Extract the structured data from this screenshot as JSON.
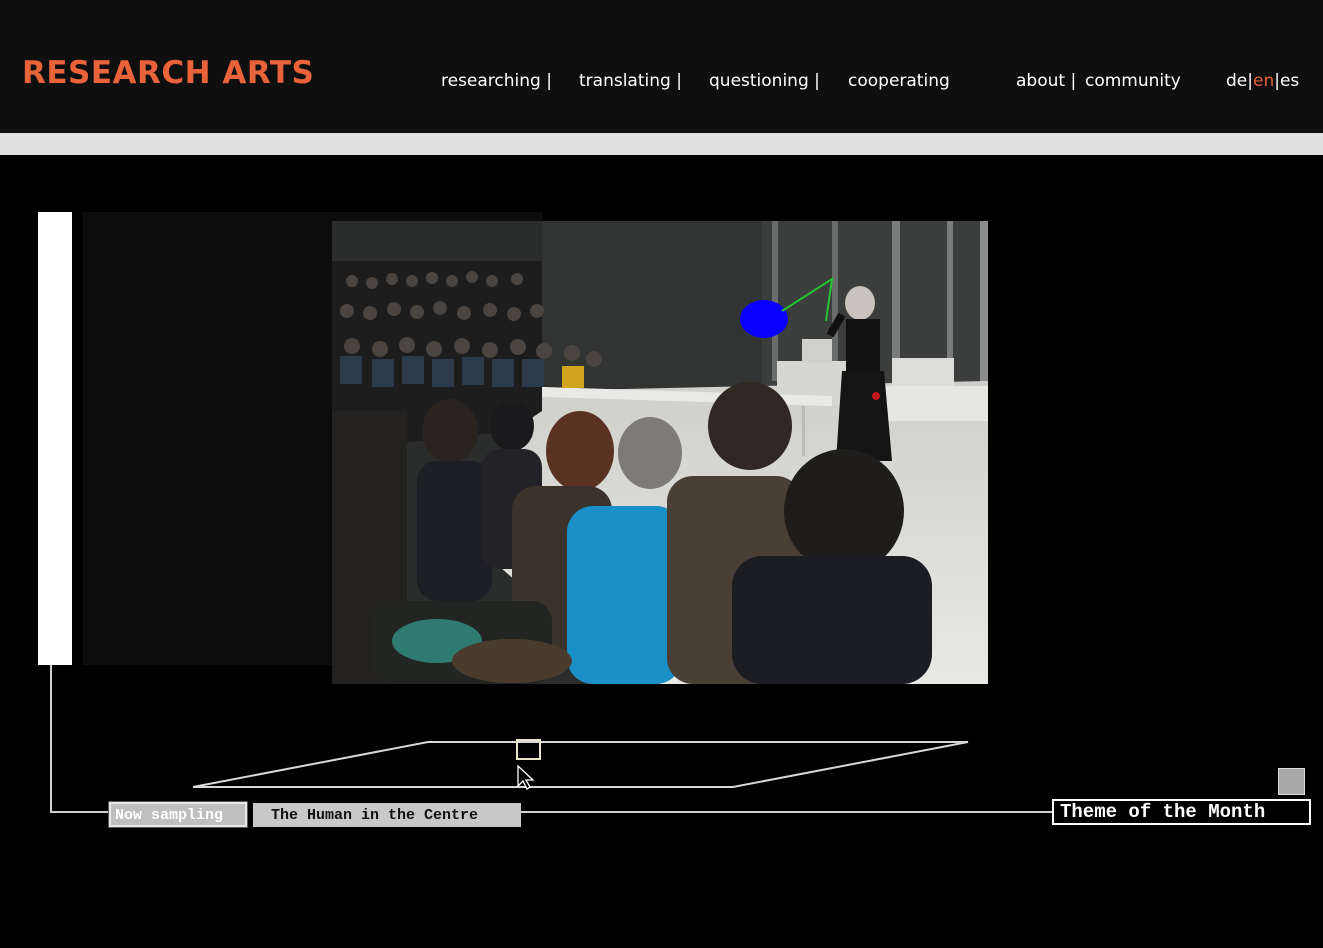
{
  "header": {
    "logo": "RESEARCH ARTS",
    "nav": [
      {
        "label": "researching",
        "sep": " |"
      },
      {
        "label": "translating",
        "sep": " |"
      },
      {
        "label": "questioning",
        "sep": " |"
      },
      {
        "label": "cooperating",
        "sep": ""
      }
    ],
    "secondary_nav": {
      "about": "about",
      "about_sep": " |",
      "community": "community"
    },
    "languages": {
      "de": "de",
      "en": "en",
      "es": "es",
      "sep": "|"
    }
  },
  "bottom": {
    "now_sampling": "Now sampling",
    "theme_title": "The Human in the Centre",
    "theme_of_month": "Theme of the Month"
  },
  "colors": {
    "accent": "#e8623a",
    "background": "#000000",
    "header_bg": "#0f0f0f"
  }
}
